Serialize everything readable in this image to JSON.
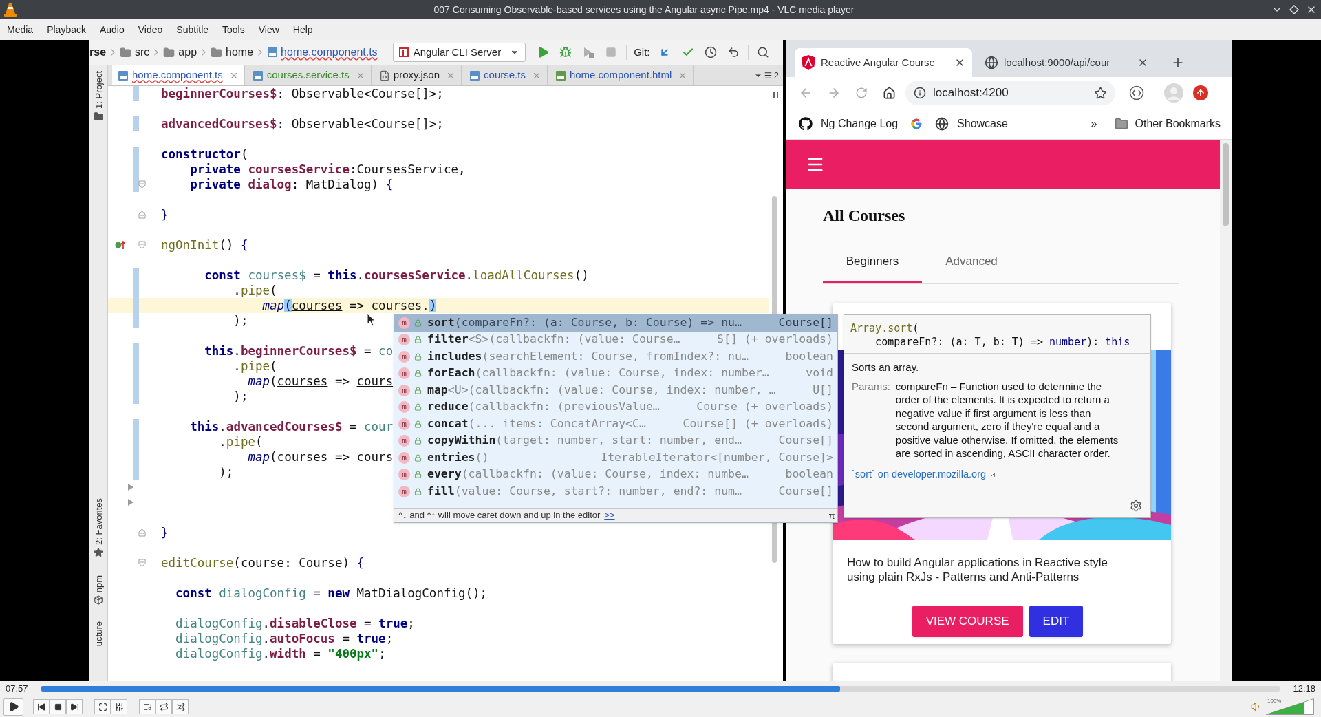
{
  "window": {
    "title": "007 Consuming Observable-based services using the Angular async Pipe.mp4 - VLC media player"
  },
  "menu": [
    "Media",
    "Playback",
    "Audio",
    "Video",
    "Subtitle",
    "Tools",
    "View",
    "Help"
  ],
  "ide": {
    "breadcrumbs": [
      {
        "label": "rse",
        "kind": "text"
      },
      {
        "label": "src",
        "kind": "folder"
      },
      {
        "label": "app",
        "kind": "folder"
      },
      {
        "label": "home",
        "kind": "folder"
      },
      {
        "label": "home.component.ts",
        "kind": "file"
      }
    ],
    "run_config": "Angular CLI Server",
    "git_label": "Git:",
    "tabs": [
      {
        "label": "home.component.ts",
        "kind": "ts",
        "color": "#2a55b5",
        "errors": true,
        "selected": true
      },
      {
        "label": "courses.service.ts",
        "kind": "ts",
        "color": "#3a8a2a",
        "errors": false,
        "selected": false
      },
      {
        "label": "proxy.json",
        "kind": "json",
        "color": "#222222",
        "errors": false,
        "selected": false
      },
      {
        "label": "course.ts",
        "kind": "ts",
        "color": "#2a55b5",
        "errors": false,
        "selected": false
      },
      {
        "label": "home.component.html",
        "kind": "html",
        "color": "#2a55b5",
        "errors": false,
        "selected": false
      }
    ],
    "tabs_overflow_count": "2",
    "tool_windows": [
      {
        "label": "1: Project",
        "kind": "folder"
      },
      {
        "label": "2: Favorites",
        "kind": "star"
      },
      {
        "label": "npm",
        "kind": "npm"
      },
      {
        "label": "ucture",
        "kind": "none"
      }
    ],
    "editor": {
      "lines": [
        {
          "changed": true,
          "current": false,
          "tokens": [
            {
              "text": "beginnerCourses$",
              "kind": "field"
            },
            {
              "text": ": Observable<Course[]>;",
              "kind": "plain"
            }
          ]
        },
        {
          "changed": false,
          "current": false
        },
        {
          "changed": true,
          "current": false,
          "tokens": [
            {
              "text": "advancedCourses$",
              "kind": "field"
            },
            {
              "text": ": Observable<Course[]>;",
              "kind": "plain"
            }
          ]
        },
        {
          "changed": false,
          "current": false
        },
        {
          "changed": true,
          "current": false,
          "tokens": [
            {
              "text": "constructor",
              "kind": "kw"
            },
            {
              "text": "(",
              "kind": "plain"
            }
          ]
        },
        {
          "changed": true,
          "current": false,
          "tokens": [
            {
              "text": "    private",
              "kind": "kw"
            },
            {
              "text": " coursesService",
              "kind": "field"
            },
            {
              "text": ":CoursesService,",
              "kind": "plain"
            }
          ]
        },
        {
          "changed": true,
          "current": false,
          "gutter": [
            {
              "kind": "foldopen"
            }
          ],
          "tokens": [
            {
              "text": "    private",
              "kind": "kw"
            },
            {
              "text": " dialog",
              "kind": "field"
            },
            {
              "text": ": MatDialog) ",
              "kind": "plain"
            },
            {
              "text": "{",
              "kind": "brace"
            }
          ]
        },
        {
          "changed": false,
          "current": false
        },
        {
          "changed": false,
          "current": false,
          "gutter": [
            {
              "kind": "foldclose"
            }
          ],
          "tokens": [
            {
              "text": "}",
              "kind": "brace"
            }
          ]
        },
        {
          "changed": false,
          "current": false
        },
        {
          "changed": false,
          "current": false,
          "gutter": [
            {
              "kind": "override"
            },
            {
              "kind": "foldopen"
            }
          ],
          "tokens": [
            {
              "text": "ngOnInit",
              "kind": "fn"
            },
            {
              "text": "() ",
              "kind": "plain"
            },
            {
              "text": "{",
              "kind": "brace"
            }
          ]
        },
        {
          "changed": false,
          "current": false
        },
        {
          "changed": true,
          "current": false,
          "tokens": [
            {
              "text": "      const",
              "kind": "kw"
            },
            {
              "text": " courses$",
              "kind": "local"
            },
            {
              "text": " = ",
              "kind": "plain"
            },
            {
              "text": "this",
              "kind": "kw"
            },
            {
              "text": ".",
              "kind": "plain"
            },
            {
              "text": "coursesService",
              "kind": "field"
            },
            {
              "text": ".",
              "kind": "plain"
            },
            {
              "text": "loadAllCourses",
              "kind": "fn"
            },
            {
              "text": "()",
              "kind": "plain"
            }
          ]
        },
        {
          "changed": true,
          "current": false,
          "tokens": [
            {
              "text": "          .",
              "kind": "plain"
            },
            {
              "text": "pipe",
              "kind": "fn"
            },
            {
              "text": "(",
              "kind": "plain"
            }
          ]
        },
        {
          "changed": true,
          "current": true,
          "tokens": [
            {
              "text": "              map",
              "kind": "italic"
            },
            {
              "text": "(",
              "kind": "match"
            },
            {
              "text": "courses",
              "kind": "param"
            },
            {
              "text": " => courses.",
              "kind": "plain"
            },
            {
              "text": ")",
              "kind": "match"
            }
          ]
        },
        {
          "changed": true,
          "current": false,
          "tokens": [
            {
              "text": "          );",
              "kind": "plain"
            }
          ]
        },
        {
          "changed": false,
          "current": false
        },
        {
          "changed": true,
          "current": false,
          "tokens": [
            {
              "text": "      this",
              "kind": "kw"
            },
            {
              "text": ".",
              "kind": "plain"
            },
            {
              "text": "beginnerCourses$",
              "kind": "field"
            },
            {
              "text": " = ",
              "kind": "plain"
            },
            {
              "text": "co",
              "kind": "local"
            }
          ]
        },
        {
          "changed": true,
          "current": false,
          "tokens": [
            {
              "text": "          .",
              "kind": "plain"
            },
            {
              "text": "pipe",
              "kind": "fn"
            },
            {
              "text": "(",
              "kind": "plain"
            }
          ]
        },
        {
          "changed": true,
          "current": false,
          "tokens": [
            {
              "text": "            map",
              "kind": "italic"
            },
            {
              "text": "(",
              "kind": "plain"
            },
            {
              "text": "courses",
              "kind": "param"
            },
            {
              "text": " => ",
              "kind": "plain"
            },
            {
              "text": "cours",
              "kind": "param"
            }
          ]
        },
        {
          "changed": true,
          "current": false,
          "tokens": [
            {
              "text": "          );",
              "kind": "plain"
            }
          ]
        },
        {
          "changed": false,
          "current": false
        },
        {
          "changed": true,
          "current": false,
          "tokens": [
            {
              "text": "    this",
              "kind": "kw"
            },
            {
              "text": ".",
              "kind": "plain"
            },
            {
              "text": "advancedCourses$",
              "kind": "field"
            },
            {
              "text": " = ",
              "kind": "plain"
            },
            {
              "text": "cour",
              "kind": "local"
            }
          ]
        },
        {
          "changed": true,
          "current": false,
          "tokens": [
            {
              "text": "        .",
              "kind": "plain"
            },
            {
              "text": "pipe",
              "kind": "fn"
            },
            {
              "text": "(",
              "kind": "plain"
            }
          ]
        },
        {
          "changed": true,
          "current": false,
          "tokens": [
            {
              "text": "            map",
              "kind": "italic"
            },
            {
              "text": "(",
              "kind": "plain"
            },
            {
              "text": "courses",
              "kind": "param"
            },
            {
              "text": " => ",
              "kind": "plain"
            },
            {
              "text": "cours",
              "kind": "param"
            }
          ]
        },
        {
          "changed": true,
          "current": false,
          "tokens": [
            {
              "text": "        );",
              "kind": "plain"
            }
          ]
        },
        {
          "changed": false,
          "current": false,
          "gutter": [
            {
              "kind": "collapsed"
            }
          ]
        },
        {
          "changed": false,
          "current": false,
          "gutter": [
            {
              "kind": "collapsed"
            }
          ]
        },
        {
          "changed": false,
          "current": false
        },
        {
          "changed": false,
          "current": false,
          "gutter": [
            {
              "kind": "foldclose"
            }
          ],
          "tokens": [
            {
              "text": "}",
              "kind": "brace"
            }
          ]
        },
        {
          "changed": false,
          "current": false
        },
        {
          "changed": false,
          "current": false,
          "gutter": [
            {
              "kind": "foldopen"
            }
          ],
          "tokens": [
            {
              "text": "editCourse",
              "kind": "fn"
            },
            {
              "text": "(",
              "kind": "plain"
            },
            {
              "text": "course",
              "kind": "param"
            },
            {
              "text": ": Course) ",
              "kind": "plain"
            },
            {
              "text": "{",
              "kind": "brace"
            }
          ]
        },
        {
          "changed": false,
          "current": false
        },
        {
          "changed": false,
          "current": false,
          "tokens": [
            {
              "text": "  const",
              "kind": "kw"
            },
            {
              "text": " dialogConfig",
              "kind": "local"
            },
            {
              "text": " = ",
              "kind": "plain"
            },
            {
              "text": "new",
              "kind": "kw"
            },
            {
              "text": " MatDialogConfig();",
              "kind": "plain"
            }
          ]
        },
        {
          "changed": false,
          "current": false
        },
        {
          "changed": false,
          "current": false,
          "tokens": [
            {
              "text": "  dialogConfig",
              "kind": "local"
            },
            {
              "text": ".",
              "kind": "plain"
            },
            {
              "text": "disableClose",
              "kind": "field"
            },
            {
              "text": " = ",
              "kind": "plain"
            },
            {
              "text": "true",
              "kind": "kw"
            },
            {
              "text": ";",
              "kind": "plain"
            }
          ]
        },
        {
          "changed": false,
          "current": false,
          "tokens": [
            {
              "text": "  dialogConfig",
              "kind": "local"
            },
            {
              "text": ".",
              "kind": "plain"
            },
            {
              "text": "autoFocus",
              "kind": "field"
            },
            {
              "text": " = ",
              "kind": "plain"
            },
            {
              "text": "true",
              "kind": "kw"
            },
            {
              "text": ";",
              "kind": "plain"
            }
          ]
        },
        {
          "changed": false,
          "current": false,
          "tokens": [
            {
              "text": "  dialogConfig",
              "kind": "local"
            },
            {
              "text": ".",
              "kind": "plain"
            },
            {
              "text": "width",
              "kind": "field"
            },
            {
              "text": " = ",
              "kind": "plain"
            },
            {
              "text": "\"400px\"",
              "kind": "string"
            },
            {
              "text": ";",
              "kind": "plain"
            }
          ]
        }
      ]
    },
    "completion": {
      "items": [
        {
          "badge": "m",
          "name": "sort",
          "signature": "(compareFn?: (a: Course, b: Course) => nu…",
          "type": "Course[]",
          "selected": true
        },
        {
          "badge": "m",
          "name": "filter",
          "signature": "<S>(callbackfn: (value: Course…",
          "type": "S[] (+ overloads)",
          "selected": false
        },
        {
          "badge": "m",
          "name": "includes",
          "signature": "(searchElement: Course, fromIndex?: nu…",
          "type": "boolean",
          "selected": false
        },
        {
          "badge": "m",
          "name": "forEach",
          "signature": "(callbackfn: (value: Course, index: number…",
          "type": "void",
          "selected": false
        },
        {
          "badge": "m",
          "name": "map",
          "signature": "<U>(callbackfn: (value: Course, index: number, …",
          "type": "U[]",
          "selected": false
        },
        {
          "badge": "m",
          "name": "reduce",
          "signature": "(callbackfn: (previousValue…",
          "type": "Course (+ overloads)",
          "selected": false
        },
        {
          "badge": "m",
          "name": "concat",
          "signature": "(... items: ConcatArray<C…",
          "type": "Course[] (+ overloads)",
          "selected": false
        },
        {
          "badge": "m",
          "name": "copyWithin",
          "signature": "(target: number, start: number, end…",
          "type": "Course[]",
          "selected": false
        },
        {
          "badge": "m",
          "name": "entries",
          "signature": "()",
          "type": "IterableIterator<[number, Course]>",
          "selected": false
        },
        {
          "badge": "m",
          "name": "every",
          "signature": "(callbackfn: (value: Course, index: numbe…",
          "type": "boolean",
          "selected": false
        },
        {
          "badge": "m",
          "name": "fill",
          "signature": "(value: Course, start?: number, end?: num…",
          "type": "Course[]",
          "selected": false
        }
      ],
      "hint": "^↓ and ^↑ will move caret down and up in the editor",
      "link": ">>",
      "pi": "π"
    },
    "documentation": {
      "code": [
        [
          {
            "text": "Array.sort",
            "kind": "fn"
          },
          {
            "text": "(",
            "kind": "plain"
          }
        ],
        [
          {
            "text": "    compareFn?: (a: T, b: T) => ",
            "kind": "plain"
          },
          {
            "text": "number",
            "kind": "kw2"
          },
          {
            "text": "): ",
            "kind": "plain"
          },
          {
            "text": "this",
            "kind": "kw2"
          }
        ]
      ],
      "summary": "Sorts an array.",
      "params_label": "Params:",
      "params_text": "compareFn – Function used to determine the order of the elements. It is expected to return a negative value if first argument is less than second argument, zero if they're equal and a positive value otherwise. If omitted, the elements are sorted in ascending, ASCII character order.",
      "link": "`sort` on developer.mozilla.org"
    }
  },
  "browser": {
    "tabs": [
      {
        "title": "Reactive Angular Course",
        "kind": "angular",
        "selected": true
      },
      {
        "title": "localhost:9000/api/cour",
        "kind": "globe",
        "selected": false
      }
    ],
    "address": "localhost:4200",
    "bookmarks": [
      {
        "label": "Ng Change Log",
        "kind": "github"
      },
      {
        "kind": "google"
      },
      {
        "label": "Showcase",
        "kind": "globe"
      }
    ],
    "bookmarks_overflow": "»",
    "other_bookmarks": "Other Bookmarks",
    "page": {
      "heading": "All Courses",
      "tabs": [
        {
          "label": "Beginners",
          "selected": true
        },
        {
          "label": "Advanced",
          "selected": false
        }
      ],
      "card": {
        "description": "How to build Angular applications in Reactive style using plain RxJs - Patterns and Anti-Patterns",
        "buttons": [
          {
            "label": "VIEW COURSE",
            "kind": "primary"
          },
          {
            "label": "EDIT",
            "kind": "accent"
          }
        ]
      }
    }
  },
  "player": {
    "seek": {
      "elapsed": "07:57",
      "total": "12:18",
      "level": 0.645
    },
    "volume": {
      "reading": "100%",
      "level": 0.8
    }
  }
}
